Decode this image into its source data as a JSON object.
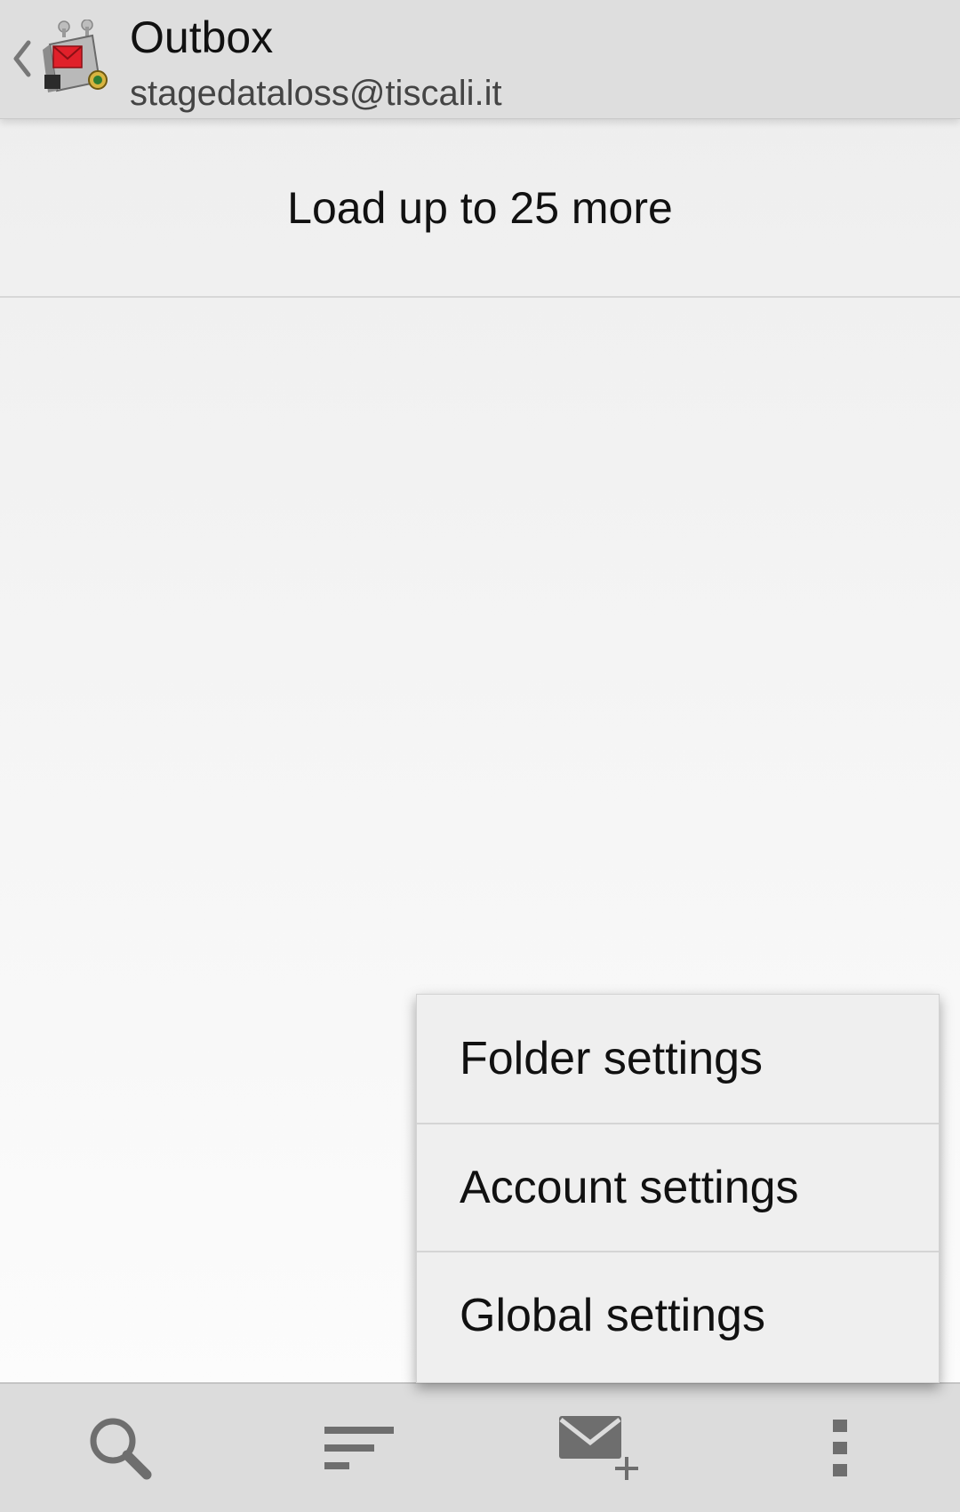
{
  "action_bar": {
    "title": "Outbox",
    "subtitle": "stagedataloss@tiscali.it",
    "icons": [
      "back-chevron-icon",
      "app-logo-icon"
    ]
  },
  "message_list": {
    "load_more_label": "Load up to 25 more"
  },
  "overflow_menu": {
    "items": [
      {
        "label": "Folder settings"
      },
      {
        "label": "Account settings"
      },
      {
        "label": "Global settings"
      }
    ]
  },
  "bottom_toolbar": {
    "buttons": [
      {
        "icon": "search-icon"
      },
      {
        "icon": "sort-icon"
      },
      {
        "icon": "compose-icon"
      },
      {
        "icon": "overflow-menu-icon"
      }
    ]
  },
  "colors": {
    "action_bar_bg": "#dedede",
    "toolbar_bg": "#dcdcdc",
    "menu_bg": "#efefef",
    "icon_gray": "#6e6e6e",
    "logo_red": "#e0202a"
  }
}
